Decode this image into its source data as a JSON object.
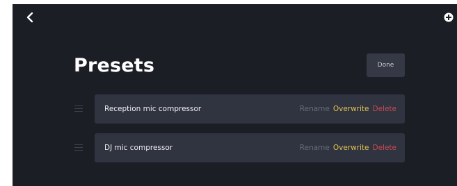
{
  "header": {
    "back_icon": "chevron-left-icon",
    "add_icon": "plus-circle-icon",
    "title": "Presets",
    "done_label": "Done"
  },
  "presets": [
    {
      "name": "Reception mic compressor",
      "rename_label": "Rename",
      "overwrite_label": "Overwrite",
      "delete_label": "Delete"
    },
    {
      "name": "DJ mic compressor",
      "rename_label": "Rename",
      "overwrite_label": "Overwrite",
      "delete_label": "Delete"
    }
  ],
  "colors": {
    "background": "#1c1e25",
    "row_background": "#303340",
    "rename": "#686b77",
    "overwrite": "#e2c14f",
    "delete": "#c94a50"
  }
}
